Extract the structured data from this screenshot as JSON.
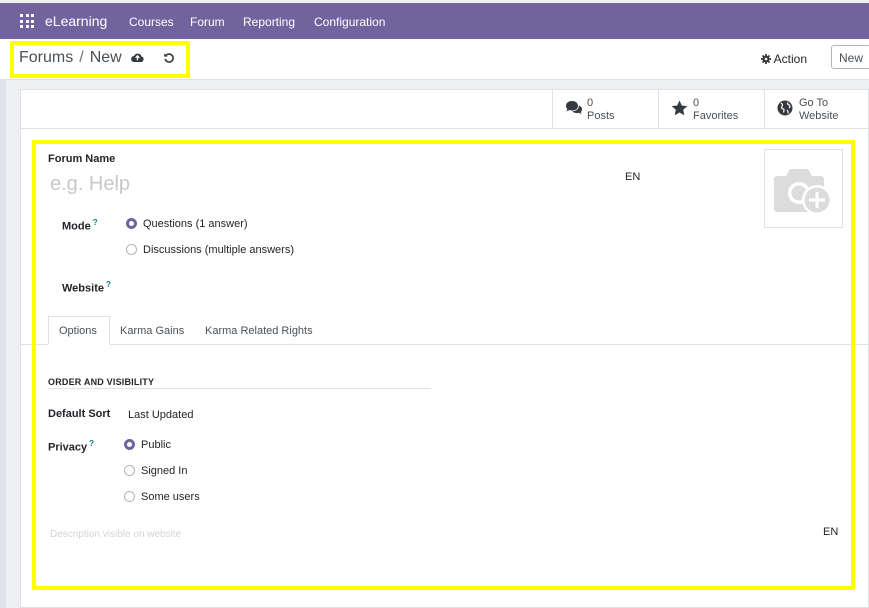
{
  "navbar": {
    "brand": "eLearning",
    "menu": [
      "Courses",
      "Forum",
      "Reporting",
      "Configuration"
    ],
    "color": "#71639e"
  },
  "breadcrumb": {
    "parent": "Forums",
    "separator": "/",
    "current": "New"
  },
  "control": {
    "action_label": "Action",
    "new_label": "New"
  },
  "stats": [
    {
      "value": "0",
      "label": "Posts",
      "icon": "comments-icon"
    },
    {
      "value": "0",
      "label": "Favorites",
      "icon": "star-icon"
    },
    {
      "value_line1": "Go To",
      "label": "Website",
      "icon": "globe-icon"
    }
  ],
  "form": {
    "forum_name_label": "Forum Name",
    "forum_name_placeholder": "e.g. Help",
    "lang_badge": "EN",
    "mode_label": "Mode",
    "mode_help": "?",
    "mode_options": [
      "Questions (1 answer)",
      "Discussions (multiple answers)"
    ],
    "mode_selected": 0,
    "website_label": "Website",
    "website_help": "?"
  },
  "tabs": [
    "Options",
    "Karma Gains",
    "Karma Related Rights"
  ],
  "options": {
    "section_title": "ORDER AND VISIBILITY",
    "default_sort_label": "Default Sort",
    "default_sort_value": "Last Updated",
    "privacy_label": "Privacy",
    "privacy_help": "?",
    "privacy_options": [
      "Public",
      "Signed In",
      "Some users"
    ],
    "privacy_selected": 0,
    "description_placeholder": "Description visible on website",
    "description_lang": "EN"
  },
  "highlight_color": "#ffff00"
}
